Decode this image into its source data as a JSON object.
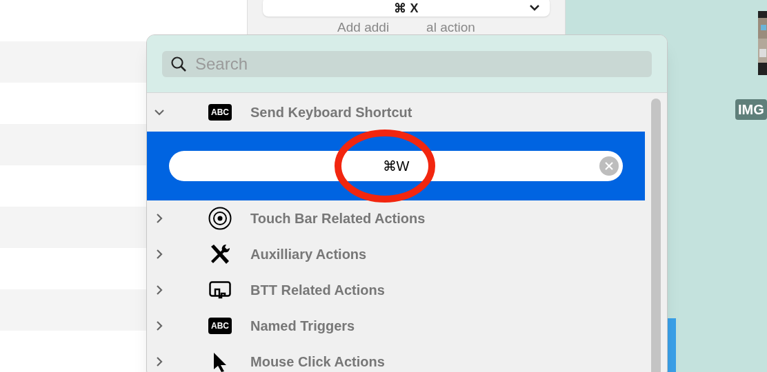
{
  "top_button": {
    "shortcut": "⌘ X"
  },
  "add_action": {
    "left": "Add addi",
    "right": "al action"
  },
  "search": {
    "placeholder": "Search"
  },
  "groups": [
    {
      "label": "Send Keyboard Shortcut",
      "kind": "text_badge",
      "badge": "ABC",
      "expanded": true,
      "children": [
        {
          "kind": "shortcut_field",
          "value": "⌘W",
          "selected": true
        }
      ]
    },
    {
      "label": "Touch Bar Related Actions",
      "kind": "target",
      "expanded": false
    },
    {
      "label": "Auxilliary Actions",
      "kind": "tools",
      "expanded": false
    },
    {
      "label": "BTT Related Actions",
      "kind": "trackpad",
      "expanded": false
    },
    {
      "label": "Named Triggers",
      "kind": "text_badge",
      "badge": "ABC",
      "expanded": false
    },
    {
      "label": "Mouse Click Actions",
      "kind": "pointer",
      "expanded": false
    }
  ],
  "desktop": {
    "file_label": "IMG"
  }
}
